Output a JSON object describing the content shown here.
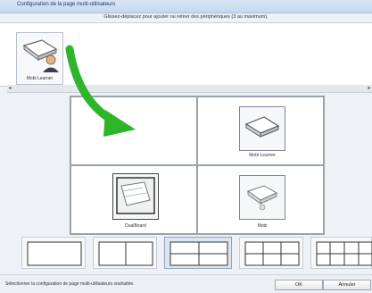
{
  "window": {
    "title": "Configuration de la page multi-utilisateurs",
    "instruction": "Glissez-déplacez pour ajouter ou retirer des périphériques (3 au maximum)."
  },
  "palette": {
    "items": [
      {
        "label": "Mobi Learner",
        "icon": "mobi-learner-user-icon"
      }
    ]
  },
  "grid": {
    "cells": [
      {
        "position": "top-left",
        "device": ""
      },
      {
        "position": "top-right",
        "device": "Mobi Learner",
        "icon": "mobi-learner-icon"
      },
      {
        "position": "bottom-left",
        "device": "DualBoard",
        "icon": "dualboard-icon"
      },
      {
        "position": "bottom-right",
        "device": "Mobi",
        "icon": "mobi-icon"
      }
    ]
  },
  "layout_options": [
    {
      "name": "1x1",
      "selected": false
    },
    {
      "name": "2x1",
      "selected": false
    },
    {
      "name": "2x2",
      "selected": true
    },
    {
      "name": "3x2",
      "selected": false
    },
    {
      "name": "4x2",
      "selected": false
    }
  ],
  "status": {
    "text": "Sélectionner la configuration de page multi-utilisateurs souhaitée."
  },
  "buttons": {
    "ok": "OK",
    "cancel": "Annuler"
  },
  "colors": {
    "accent_arrow": "#2fb52a",
    "titlebar": "#c5d8ef"
  }
}
